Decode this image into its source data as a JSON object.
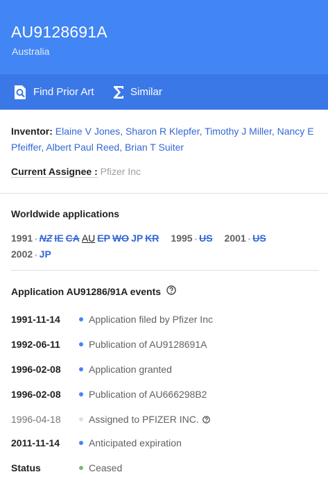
{
  "header": {
    "publication_number": "AU9128691A",
    "country": "Australia",
    "background_color": "#4285f4"
  },
  "toolbar": {
    "find_prior_art": {
      "label": "Find Prior Art",
      "icon": "search-document-icon"
    },
    "similar": {
      "label": "Similar",
      "icon": "sigma-icon"
    }
  },
  "inventors": {
    "label": "Inventor:",
    "names": [
      "Elaine V Jones",
      "Sharon R Klepfer",
      "Timothy J Miller",
      "Nancy E Pfeiffer",
      "Albert Paul Reed",
      "Brian T Suiter"
    ]
  },
  "assignee": {
    "label": "Current Assignee :",
    "value": "Pfizer Inc"
  },
  "worldwide": {
    "title": "Worldwide applications",
    "groups": [
      {
        "year": "1991",
        "countries": [
          {
            "code": "NZ",
            "style": "italic-strike"
          },
          {
            "code": "IE",
            "style": "strike"
          },
          {
            "code": "CA",
            "style": "strike"
          },
          {
            "code": "AU",
            "style": "current"
          },
          {
            "code": "EP",
            "style": "strike"
          },
          {
            "code": "WO",
            "style": "strike"
          },
          {
            "code": "JP",
            "style": "link"
          },
          {
            "code": "KR",
            "style": "strike"
          }
        ]
      },
      {
        "year": "1995",
        "countries": [
          {
            "code": "US",
            "style": "strike"
          }
        ]
      },
      {
        "year": "2001",
        "countries": [
          {
            "code": "US",
            "style": "strike"
          }
        ]
      },
      {
        "year": "2002",
        "countries": [
          {
            "code": "JP",
            "style": "link"
          }
        ]
      }
    ]
  },
  "events": {
    "title": "Application AU91286/91A events",
    "items": [
      {
        "date": "1991-11-14",
        "title": "Application filed by Pfizer Inc",
        "dot": "blue"
      },
      {
        "date": "1992-06-11",
        "title": "Publication of AU9128691A",
        "dot": "blue"
      },
      {
        "date": "1996-02-08",
        "title": "Application granted",
        "dot": "blue"
      },
      {
        "date": "1996-02-08",
        "title": "Publication of AU666298B2",
        "dot": "blue"
      },
      {
        "date": "1996-04-18",
        "title": "Assigned to PFIZER INC.",
        "dot": "grey",
        "light": true,
        "help": true
      },
      {
        "date": "2011-11-14",
        "title": "Anticipated expiration",
        "dot": "blue"
      },
      {
        "date": "Status",
        "title": "Ceased",
        "dot": "green"
      }
    ]
  }
}
